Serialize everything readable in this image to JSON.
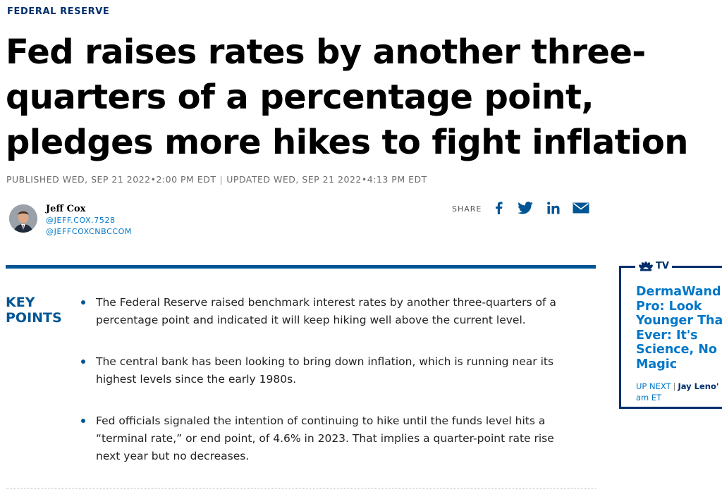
{
  "section": "FEDERAL RESERVE",
  "headline": {
    "line1": "Fed raises rates by another three-",
    "line2": "quarters of a percentage point,",
    "line3": "pledges more hikes to fight inflation"
  },
  "timestamps": {
    "published": "PUBLISHED WED, SEP 21 2022•2:00 PM EDT",
    "separator": "|",
    "updated": "UPDATED WED, SEP 21 2022•4:13 PM EDT"
  },
  "author": {
    "name": "Jeff Cox",
    "handle1": "@JEFF.COX.7528",
    "handle2": "@JEFFCOXCNBCCOM"
  },
  "share": {
    "label": "SHARE",
    "icons": [
      "facebook-icon",
      "twitter-icon",
      "linkedin-icon",
      "email-icon"
    ]
  },
  "key_points": {
    "label_line1": "KEY",
    "label_line2": "POINTS",
    "items": [
      "The Federal Reserve raised benchmark interest rates by another three-quarters of a percentage point and indicated it will keep hiking well above the current level.",
      "The central bank has been looking to bring down inflation, which is running near its highest levels since the early 1980s.",
      "Fed officials signaled the intention of continuing to hike until the funds level hits a “terminal rate,” or end point, of 4.6% in 2023. That implies a quarter-point rate rise next year but no decreases."
    ]
  },
  "tv_widget": {
    "brand": "TV",
    "title_lines": [
      "DermaWand",
      "Pro: Look",
      "Younger Tha",
      "Ever: It's",
      "Science, No",
      "Magic"
    ],
    "up_next_label": "UP NEXT",
    "separator": "|",
    "up_next_show": "Jay Leno'",
    "up_next_time": "am ET"
  },
  "colors": {
    "brand_navy": "#002f6c",
    "accent_blue": "#005594",
    "link_blue": "#0077c8"
  }
}
